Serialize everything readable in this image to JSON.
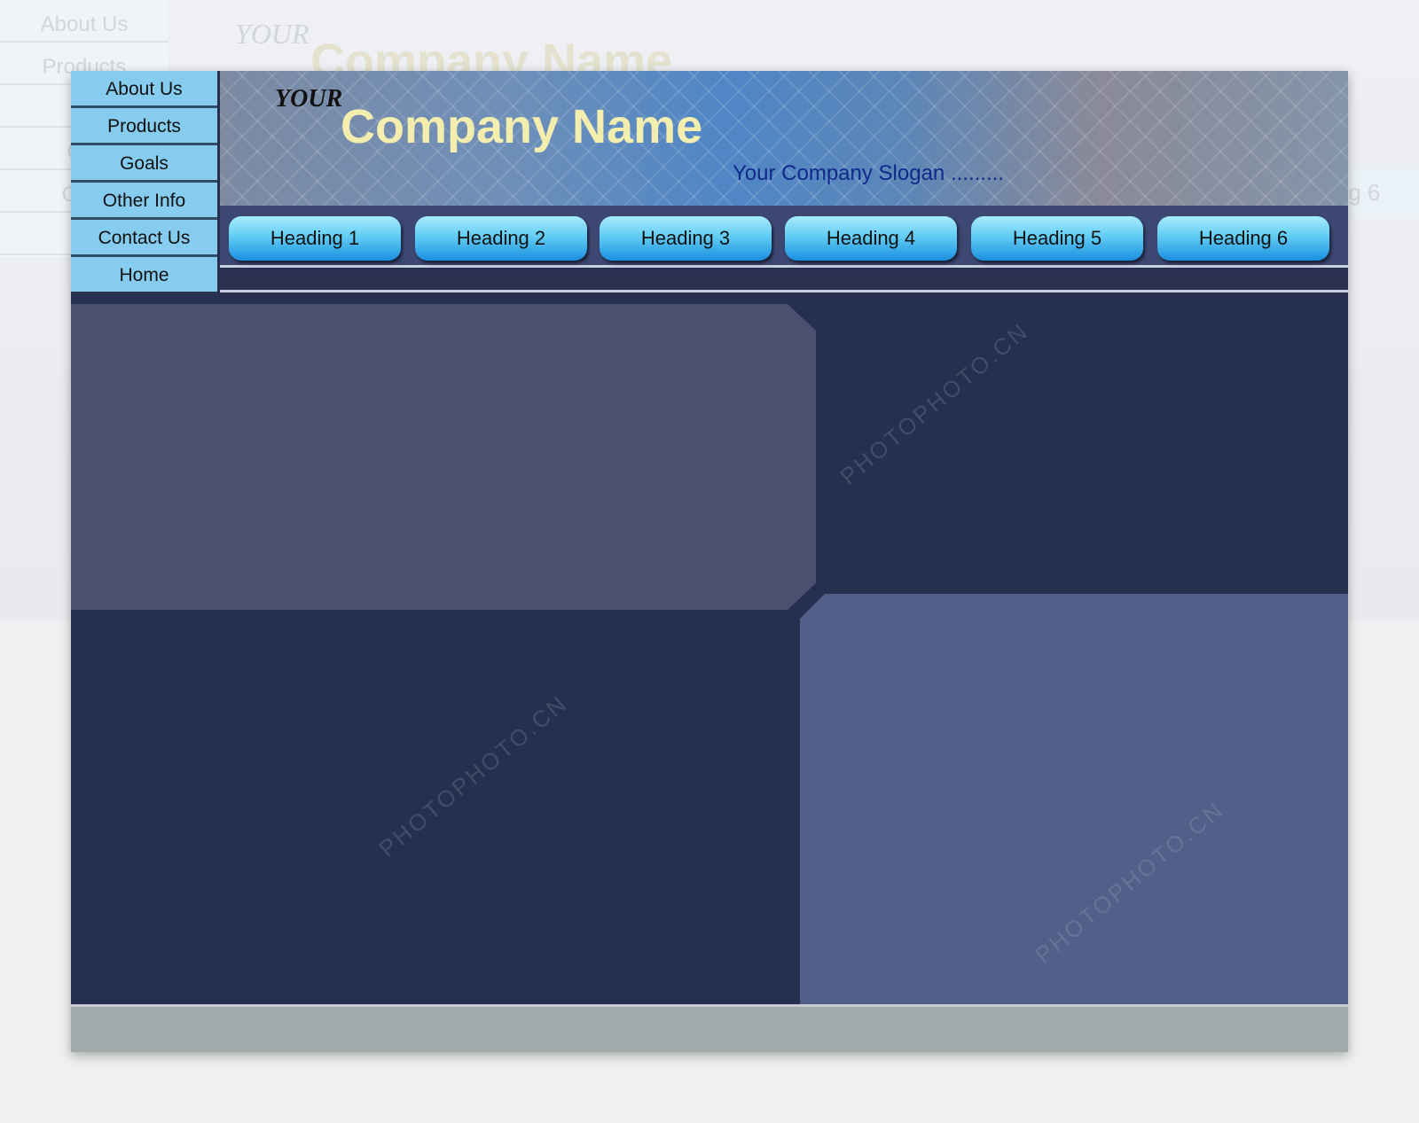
{
  "sidebar": {
    "items": [
      {
        "label": "About Us"
      },
      {
        "label": "Products"
      },
      {
        "label": "Goals"
      },
      {
        "label": "Other Info"
      },
      {
        "label": "Contact Us"
      },
      {
        "label": "Home"
      }
    ]
  },
  "header": {
    "your": "YOUR",
    "company_name": "Company Name",
    "slogan": "Your Company Slogan ........."
  },
  "nav": {
    "items": [
      {
        "label": "Heading 1"
      },
      {
        "label": "Heading 2"
      },
      {
        "label": "Heading 3"
      },
      {
        "label": "Heading 4"
      },
      {
        "label": "Heading 5"
      },
      {
        "label": "Heading 6"
      }
    ]
  },
  "background_ghost": {
    "sidebar": [
      "About Us",
      "Products",
      "G",
      "Oth",
      "Cont",
      "H"
    ],
    "your": "YOUR",
    "company_name": "Company Name",
    "heading6": "ing 6"
  },
  "watermark": "PHOTOPHOTO.CN",
  "colors": {
    "frame": "#262f4f",
    "sidebar": "#86ccee",
    "title": "#f3eeae",
    "slogan": "#0f2a8a",
    "footer": "#a3aaac"
  }
}
